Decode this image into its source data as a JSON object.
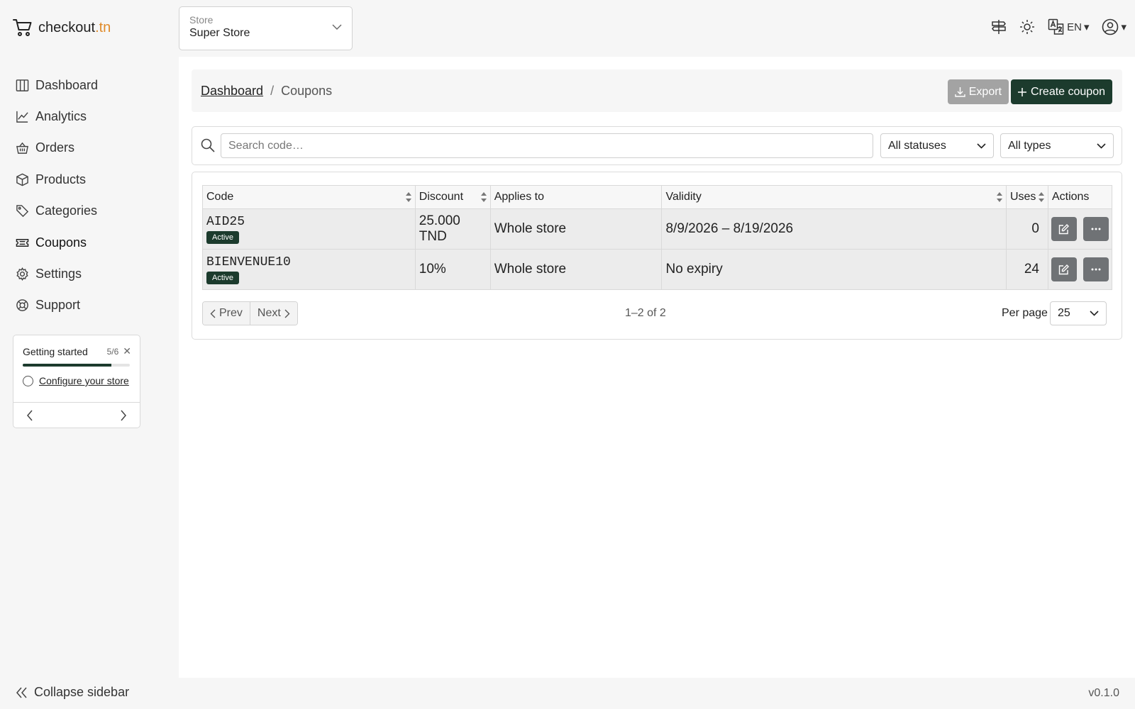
{
  "brand": {
    "name": "checkout",
    "tld": ".tn"
  },
  "store": {
    "label": "Store",
    "value": "Super Store"
  },
  "header": {
    "language": "EN"
  },
  "sidebar": {
    "items": [
      {
        "label": "Dashboard",
        "icon": "columns-icon"
      },
      {
        "label": "Analytics",
        "icon": "chart-line-icon"
      },
      {
        "label": "Orders",
        "icon": "basket-icon"
      },
      {
        "label": "Products",
        "icon": "box-icon"
      },
      {
        "label": "Categories",
        "icon": "tags-icon"
      },
      {
        "label": "Coupons",
        "icon": "ticket-icon",
        "active": true
      },
      {
        "label": "Settings",
        "icon": "gear-icon"
      },
      {
        "label": "Support",
        "icon": "lifebuoy-icon"
      }
    ],
    "collapse_label": "Collapse sidebar"
  },
  "getting_started": {
    "title": "Getting started",
    "count": "5/6",
    "progress": 0.83,
    "task": "Configure your store"
  },
  "breadcrumb": {
    "parent": "Dashboard",
    "separator": "/",
    "current": "Coupons"
  },
  "actions": {
    "export_label": "Export",
    "create_label": "Create coupon"
  },
  "filters": {
    "search_placeholder": "Search code…",
    "status": "All statuses",
    "type": "All types"
  },
  "table": {
    "columns": [
      "Code",
      "Discount",
      "Applies to",
      "Validity",
      "Uses",
      "Actions"
    ],
    "rows": [
      {
        "code": "AID25",
        "status": "Active",
        "discount": "25.000 TND",
        "applies_to": "Whole store",
        "validity": "8/9/2026 – 8/19/2026",
        "uses": "0"
      },
      {
        "code": "BIENVENUE10",
        "status": "Active",
        "discount": "10%",
        "applies_to": "Whole store",
        "validity": "No expiry",
        "uses": "24"
      }
    ]
  },
  "pagination": {
    "prev": "Prev",
    "next": "Next",
    "range": "1–2 of 2",
    "per_page_label": "Per page",
    "per_page": "25"
  },
  "version": "v0.1.0",
  "colors": {
    "accent": "#1c3b2d",
    "tld": "#e08b2a",
    "export_bg": "#a3a3a3"
  }
}
